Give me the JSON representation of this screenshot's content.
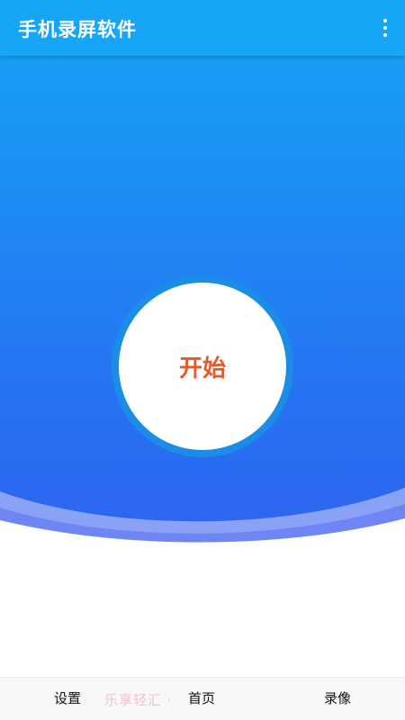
{
  "appbar": {
    "title": "手机录屏软件",
    "menu_icon": "more-vert-icon"
  },
  "main": {
    "start_label": "开始"
  },
  "bottom_nav": {
    "items": [
      {
        "label": "设置"
      },
      {
        "label": "首页"
      },
      {
        "label": "录像"
      }
    ],
    "watermark": "乐享轻汇 ·"
  },
  "colors": {
    "appbar": "#17a6f6",
    "gradient_top": "#14a5f5",
    "gradient_bottom": "#2f63ef",
    "start_text": "#e65a2a",
    "ring": "#1b8de6"
  }
}
